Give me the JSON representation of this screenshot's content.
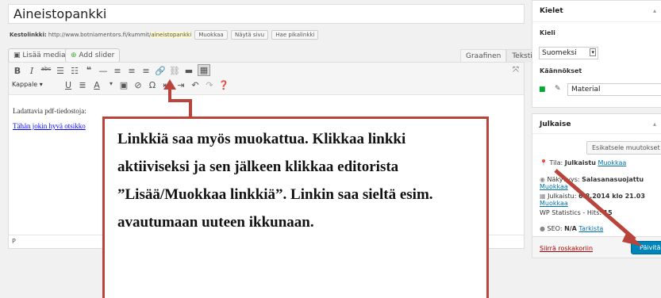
{
  "post": {
    "title": "Aineistopankki",
    "permalink_label": "Kestolinkki:",
    "permalink_base": "http://www.botniamentors.fi/kummit/",
    "permalink_slug": "aineistopankki",
    "buttons": [
      "Muokkaa",
      "Näytä sivu",
      "Hae pikalinkki"
    ]
  },
  "media": {
    "add_media": "Lisää media",
    "add_slider": "Add slider"
  },
  "editor_tabs": [
    "Graafinen",
    "Teksti"
  ],
  "toolbar": {
    "format_select": "Kappale",
    "row1_icons": [
      "bold-icon",
      "italic-icon",
      "strikethrough-icon",
      "bullet-list-icon",
      "numbered-list-icon",
      "blockquote-icon",
      "horizontal-rule-icon",
      "align-left-icon",
      "align-center-icon",
      "align-right-icon",
      "insert-link-icon",
      "unlink-icon",
      "read-more-icon",
      "toolbar-toggle-icon"
    ],
    "row2_icons": [
      "underline-icon",
      "justify-icon",
      "text-color-icon",
      "paste-text-icon",
      "clear-format-icon",
      "special-char-icon",
      "outdent-icon",
      "indent-icon",
      "undo-icon",
      "redo-icon",
      "help-icon"
    ]
  },
  "content": {
    "line1": "Ladattavia pdf-tiedostoja:",
    "link": "Tähän jokin hyvä otsikko"
  },
  "statusbar": {
    "path": "P"
  },
  "sidebar": {
    "kielet": {
      "title": "Kielet",
      "kieli_label": "Kieli",
      "kieli_value": "Suomeksi",
      "translations_label": "Käännökset",
      "translation_value": "Material"
    },
    "julkaise": {
      "title": "Julkaise",
      "preview_button": "Esikatsele muutokset",
      "status_label": "Tila:",
      "status_value": "Julkaistu",
      "status_edit": "Muokkaa",
      "visibility_label": "Näkyvyys:",
      "visibility_value": "Salasanasuojattu",
      "visibility_edit": "Muokkaa",
      "published_label": "Julkaistu:",
      "published_value": "6.8.2014 klo 21.03",
      "published_edit": "Muokkaa",
      "wpstats_label": "WP Statistics - Hits:",
      "wpstats_value": "15",
      "seo_label": "SEO:",
      "seo_value": "N/A",
      "seo_link": "Tarkista",
      "trash": "Siirrä roskakoriin",
      "update": "Päivitä"
    }
  },
  "callout": {
    "text": "Linkkiä saa myös muokattua. Klikkaa linkki aktiiviseksi ja sen jälkeen klikkaa editorista ”Lisää/Muokkaa linkkiä”. Linkin saa sieltä esim. avautumaan uuteen ikkunaan."
  },
  "colors": {
    "annotation": "#b9443b",
    "primary": "#0085ba"
  }
}
